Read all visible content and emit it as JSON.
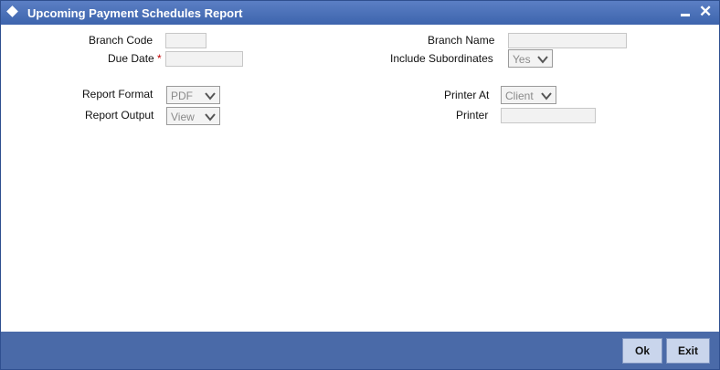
{
  "window": {
    "title": "Upcoming Payment Schedules Report"
  },
  "form": {
    "branch_code_label": "Branch Code",
    "branch_code_value": "",
    "due_date_label": "Due Date",
    "due_date_required": "*",
    "due_date_value": "",
    "branch_name_label": "Branch Name",
    "branch_name_value": "",
    "include_subordinates_label": "Include Subordinates",
    "include_subordinates_value": "Yes",
    "report_format_label": "Report Format",
    "report_format_value": "PDF",
    "report_output_label": "Report Output",
    "report_output_value": "View",
    "printer_at_label": "Printer At",
    "printer_at_value": "Client",
    "printer_label": "Printer",
    "printer_value": ""
  },
  "footer": {
    "ok_label": "Ok",
    "exit_label": "Exit"
  },
  "icons": {
    "title": "diamond-icon",
    "minimize": "minimize-icon",
    "close": "close-icon",
    "dropdown": "chevron-down-icon"
  }
}
